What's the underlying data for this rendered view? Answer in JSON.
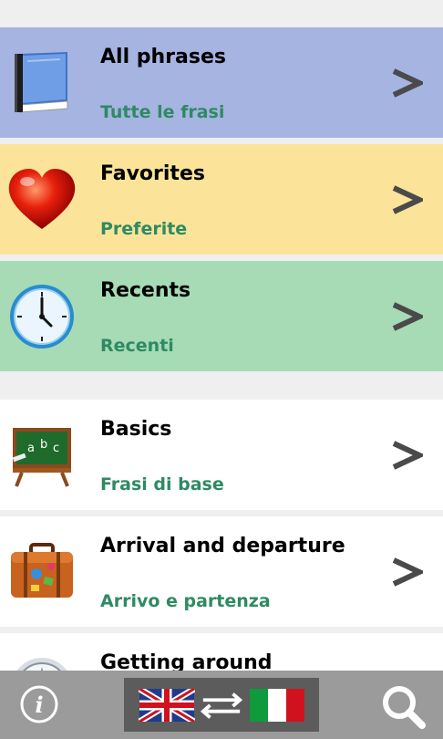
{
  "categories": [
    {
      "title": "All phrases",
      "subtitle": "Tutte le frasi",
      "icon": "book-icon",
      "bg": "#a6b4e2"
    },
    {
      "title": "Favorites",
      "subtitle": "Preferite",
      "icon": "heart-icon",
      "bg": "#fbe49a"
    },
    {
      "title": "Recents",
      "subtitle": "Recenti",
      "icon": "clock-icon",
      "bg": "#a6dbb5"
    },
    {
      "title": "Basics",
      "subtitle": "Frasi di base",
      "icon": "chalkboard-icon",
      "bg": "#ffffff"
    },
    {
      "title": "Arrival and departure",
      "subtitle": "Arrivo e partenza",
      "icon": "suitcase-icon",
      "bg": "#ffffff"
    },
    {
      "title": "Getting around",
      "subtitle": "",
      "icon": "compass-icon",
      "bg": "#ffffff"
    }
  ],
  "chevron_glyph": ">",
  "bottom_bar": {
    "info_icon": "info-icon",
    "info_glyph": "i",
    "language_from_icon": "uk-flag-icon",
    "swap_icon": "swap-arrows-icon",
    "language_to_icon": "italy-flag-icon",
    "search_icon": "search-icon"
  },
  "colors": {
    "subtitle": "#2e8a63",
    "bar_bg": "#9b9b9b",
    "switch_bg": "#5c5c5c"
  }
}
